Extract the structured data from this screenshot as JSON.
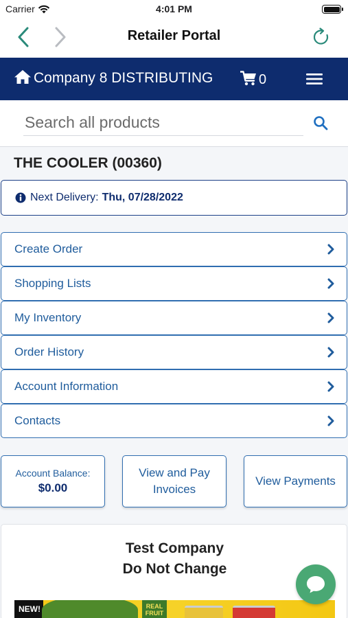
{
  "status_bar": {
    "carrier": "Carrier",
    "time": "4:01 PM"
  },
  "navbar": {
    "title": "Retailer Portal"
  },
  "header": {
    "company": "Company 8 DISTRIBUTING",
    "cart_count": "0"
  },
  "search": {
    "placeholder": "Search all products"
  },
  "store": {
    "name": "THE COOLER (00360)"
  },
  "delivery": {
    "label": "Next Delivery:",
    "date": "Thu, 07/28/2022"
  },
  "menu": {
    "items": [
      {
        "label": "Create Order"
      },
      {
        "label": "Shopping Lists"
      },
      {
        "label": "My Inventory"
      },
      {
        "label": "Order History"
      },
      {
        "label": "Account Information"
      },
      {
        "label": "Contacts"
      }
    ]
  },
  "tiles": {
    "balance_label": "Account Balance:",
    "balance_value": "$0.00",
    "invoices_line1": "View and Pay",
    "invoices_line2": "Invoices",
    "payments": "View Payments"
  },
  "company_card": {
    "line1": "Test Company",
    "line2": "Do Not Change"
  },
  "banner": {
    "badge": "NEW!",
    "brand_line1": "REAL",
    "brand_line2": "FRUIT"
  },
  "colors": {
    "primary": "#0e2c6e",
    "link": "#1f5c9c",
    "accent": "#2a8a7a",
    "chat": "#4aa874"
  }
}
